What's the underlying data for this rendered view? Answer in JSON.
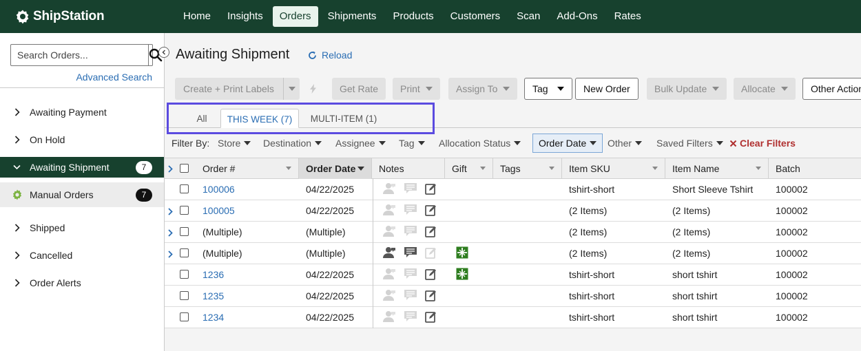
{
  "app": {
    "logo_text": "ShipStation",
    "nav": [
      "Home",
      "Insights",
      "Orders",
      "Shipments",
      "Products",
      "Customers",
      "Scan",
      "Add-Ons",
      "Rates"
    ],
    "active_nav": "Orders"
  },
  "sidebar": {
    "search_placeholder": "Search Orders...",
    "advanced_search": "Advanced Search",
    "items": [
      {
        "label": "Awaiting Payment"
      },
      {
        "label": "On Hold"
      },
      {
        "label": "Awaiting Shipment",
        "count": "7",
        "active": true
      },
      {
        "label": "Manual Orders",
        "count": "7",
        "sub": true
      },
      {
        "label": "Shipped"
      },
      {
        "label": "Cancelled"
      },
      {
        "label": "Order Alerts"
      }
    ]
  },
  "main": {
    "title": "Awaiting Shipment",
    "reload": "Reload",
    "toolbar": {
      "create_print": "Create + Print Labels",
      "get_rate": "Get Rate",
      "print": "Print",
      "assign_to": "Assign To",
      "tag": "Tag",
      "new_order": "New Order",
      "bulk_update": "Bulk Update",
      "allocate": "Allocate",
      "other_actions": "Other Actions"
    },
    "tabs": [
      {
        "label": "All"
      },
      {
        "label": "THIS WEEK (7)",
        "active": true
      },
      {
        "label": "MULTI-ITEM (1)"
      }
    ],
    "filters": {
      "label": "Filter By:",
      "items": [
        "Store",
        "Destination",
        "Assignee",
        "Tag",
        "Allocation Status",
        "Order Date",
        "Other",
        "Saved Filters"
      ],
      "active": "Order Date",
      "clear": "Clear Filters"
    },
    "table": {
      "columns": [
        "Order #",
        "Order Date",
        "Notes",
        "Gift",
        "Tags",
        "Item SKU",
        "Item Name",
        "Batch"
      ],
      "sorted_column": "Order Date",
      "rows": [
        {
          "order": "100006",
          "order_link": true,
          "date": "04/22/2025",
          "sku": "tshirt-short",
          "name": "Short Sleeve Tshirt",
          "batch": "100002",
          "expand": false,
          "gift": false,
          "notes_active": false
        },
        {
          "order": "100005",
          "order_link": true,
          "date": "04/22/2025",
          "sku": "(2 Items)",
          "name": "(2 Items)",
          "batch": "100002",
          "expand": true,
          "gift": false,
          "notes_active": false
        },
        {
          "order": "(Multiple)",
          "order_link": false,
          "date": "(Multiple)",
          "sku": "(2 Items)",
          "name": "(2 Items)",
          "batch": "100002",
          "expand": true,
          "gift": false,
          "notes_active": false
        },
        {
          "order": "(Multiple)",
          "order_link": false,
          "date": "(Multiple)",
          "sku": "(2 Items)",
          "name": "(2 Items)",
          "batch": "100002",
          "expand": true,
          "gift": true,
          "notes_active": true
        },
        {
          "order": "1236",
          "order_link": true,
          "date": "04/22/2025",
          "sku": "tshirt-short",
          "name": "short tshirt",
          "batch": "100002",
          "expand": false,
          "gift": true,
          "notes_active": false
        },
        {
          "order": "1235",
          "order_link": true,
          "date": "04/22/2025",
          "sku": "tshirt-short",
          "name": "short tshirt",
          "batch": "100002",
          "expand": false,
          "gift": false,
          "notes_active": false
        },
        {
          "order": "1234",
          "order_link": true,
          "date": "04/22/2025",
          "sku": "tshirt-short",
          "name": "short tshirt",
          "batch": "100002",
          "expand": false,
          "gift": false,
          "notes_active": false
        }
      ]
    }
  },
  "colors": {
    "brand_dark": "#17412e",
    "link": "#2a6db3",
    "highlight": "#5b4be0",
    "gift": "#2e7d1f",
    "clear": "#b03030"
  }
}
